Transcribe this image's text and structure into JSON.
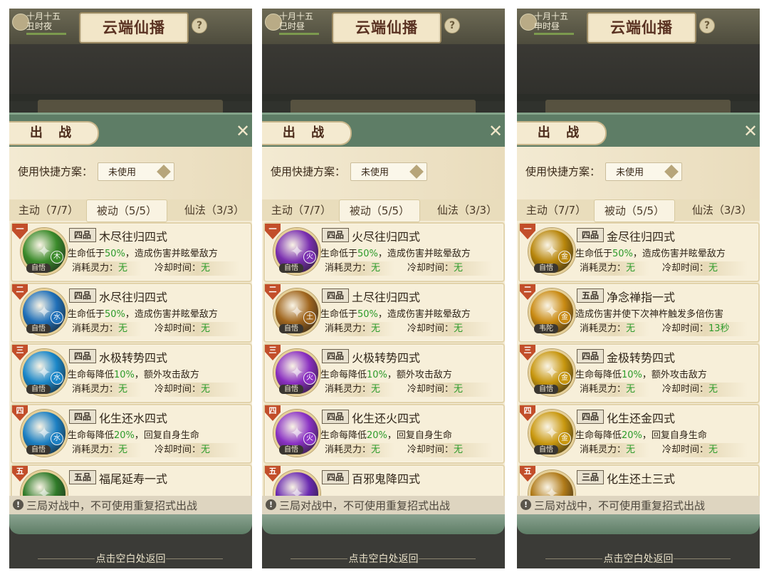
{
  "panels": [
    {
      "date_line1": "十月十五",
      "date_line2": "丑时夜",
      "title": "云端仙播",
      "dialog_title": "出 战",
      "scheme_label": "使用快捷方案：",
      "scheme_value": "未使用",
      "tabs": [
        "主动（7/7）",
        "被动（5/5）",
        "仙法（3/3）"
      ],
      "active_tab": 1,
      "skills": [
        {
          "num": "一",
          "grade": "四品",
          "name": "木尽往归四式",
          "desc_pre": "生命低于",
          "desc_pct": "50%",
          "desc_post": "，造成伤害并眩晕敌方",
          "cost_label": "消耗灵力：",
          "cost": "无",
          "cd_label": "冷却时间：",
          "cd": "无",
          "source": "自悟",
          "element": "木",
          "color": "#3a8a2a"
        },
        {
          "num": "二",
          "grade": "四品",
          "name": "水尽往归四式",
          "desc_pre": "生命低于",
          "desc_pct": "50%",
          "desc_post": "，造成伤害并眩晕敌方",
          "cost_label": "消耗灵力：",
          "cost": "无",
          "cd_label": "冷却时间：",
          "cd": "无",
          "source": "自悟",
          "element": "水",
          "color": "#1f6fb8"
        },
        {
          "num": "三",
          "grade": "四品",
          "name": "水极转势四式",
          "desc_pre": "生命每降低",
          "desc_pct": "10%",
          "desc_post": "，额外攻击敌方",
          "cost_label": "消耗灵力：",
          "cost": "无",
          "cd_label": "冷却时间：",
          "cd": "无",
          "source": "自悟",
          "element": "水",
          "color": "#1a86c8"
        },
        {
          "num": "四",
          "grade": "四品",
          "name": "化生还水四式",
          "desc_pre": "生命每降低",
          "desc_pct": "20%",
          "desc_post": "，回复自身生命",
          "cost_label": "消耗灵力：",
          "cost": "无",
          "cd_label": "冷却时间：",
          "cd": "无",
          "source": "自悟",
          "element": "水",
          "color": "#1b7fc2"
        },
        {
          "num": "五",
          "grade": "五品",
          "name": "福尾延寿一式",
          "desc_pre": "",
          "desc_pct": "",
          "desc_post": "",
          "cost_label": "",
          "cost": "",
          "cd_label": "",
          "cd": "",
          "source": "",
          "element": "",
          "color": "#2f7a28"
        }
      ],
      "notice": "三局对战中，不可使用重复招式出战",
      "return_text": "点击空白处返回"
    },
    {
      "date_line1": "十月十五",
      "date_line2": "巳时昼",
      "title": "云端仙播",
      "dialog_title": "出 战",
      "scheme_label": "使用快捷方案：",
      "scheme_value": "未使用",
      "tabs": [
        "主动（7/7）",
        "被动（5/5）",
        "仙法（3/3）"
      ],
      "active_tab": 1,
      "skills": [
        {
          "num": "一",
          "grade": "四品",
          "name": "火尽往归四式",
          "desc_pre": "生命低于",
          "desc_pct": "50%",
          "desc_post": "，造成伤害并眩晕敌方",
          "cost_label": "消耗灵力：",
          "cost": "无",
          "cd_label": "冷却时间：",
          "cd": "无",
          "source": "自悟",
          "element": "火",
          "color": "#7a2fb0"
        },
        {
          "num": "二",
          "grade": "四品",
          "name": "土尽往归四式",
          "desc_pre": "生命低于",
          "desc_pct": "50%",
          "desc_post": "，造成伤害并眩晕敌方",
          "cost_label": "消耗灵力：",
          "cost": "无",
          "cd_label": "冷却时间：",
          "cd": "无",
          "source": "自悟",
          "element": "土",
          "color": "#a0661e"
        },
        {
          "num": "三",
          "grade": "四品",
          "name": "火极转势四式",
          "desc_pre": "生命每降低",
          "desc_pct": "10%",
          "desc_post": "，额外攻击敌方",
          "cost_label": "消耗灵力：",
          "cost": "无",
          "cd_label": "冷却时间：",
          "cd": "无",
          "source": "自悟",
          "element": "火",
          "color": "#8a2fc0"
        },
        {
          "num": "四",
          "grade": "四品",
          "name": "化生还火四式",
          "desc_pre": "生命每降低",
          "desc_pct": "20%",
          "desc_post": "，回复自身生命",
          "cost_label": "消耗灵力：",
          "cost": "无",
          "cd_label": "冷却时间：",
          "cd": "无",
          "source": "自悟",
          "element": "火",
          "color": "#8a32c4"
        },
        {
          "num": "五",
          "grade": "四品",
          "name": "百邪鬼降四式",
          "desc_pre": "",
          "desc_pct": "",
          "desc_post": "",
          "cost_label": "",
          "cost": "",
          "cd_label": "",
          "cd": "",
          "source": "",
          "element": "",
          "color": "#6a2ab0"
        }
      ],
      "notice": "三局对战中，不可使用重复招式出战",
      "return_text": "点击空白处返回"
    },
    {
      "date_line1": "十月十五",
      "date_line2": "申时昼",
      "title": "云端仙播",
      "dialog_title": "出 战",
      "scheme_label": "使用快捷方案：",
      "scheme_value": "未使用",
      "tabs": [
        "主动（7/7）",
        "被动（5/5）",
        "仙法（3/3）"
      ],
      "active_tab": 1,
      "skills": [
        {
          "num": "一",
          "grade": "四品",
          "name": "金尽往归四式",
          "desc_pre": "生命低于",
          "desc_pct": "50%",
          "desc_post": "，造成伤害并眩晕敌方",
          "cost_label": "消耗灵力：",
          "cost": "无",
          "cd_label": "冷却时间：",
          "cd": "无",
          "source": "自悟",
          "element": "金",
          "color": "#b8860b"
        },
        {
          "num": "二",
          "grade": "五品",
          "name": "净念禅指一式",
          "desc_pre": "造成伤害并使下次神杵触发多倍伤害",
          "desc_pct": "",
          "desc_post": "",
          "cost_label": "消耗灵力：",
          "cost": "无",
          "cd_label": "冷却时间：",
          "cd": "13秒",
          "source": "韦陀",
          "element": "金",
          "color": "#c98a12"
        },
        {
          "num": "三",
          "grade": "四品",
          "name": "金极转势四式",
          "desc_pre": "生命每降低",
          "desc_pct": "10%",
          "desc_post": "，额外攻击敌方",
          "cost_label": "消耗灵力：",
          "cost": "无",
          "cd_label": "冷却时间：",
          "cd": "无",
          "source": "自悟",
          "element": "金",
          "color": "#c7960e"
        },
        {
          "num": "四",
          "grade": "四品",
          "name": "化生还金四式",
          "desc_pre": "生命每降低",
          "desc_pct": "20%",
          "desc_post": "，回复自身生命",
          "cost_label": "消耗灵力：",
          "cost": "无",
          "cd_label": "冷却时间：",
          "cd": "无",
          "source": "自悟",
          "element": "金",
          "color": "#c9980f"
        },
        {
          "num": "五",
          "grade": "三品",
          "name": "化生还土三式",
          "desc_pre": "",
          "desc_pct": "",
          "desc_post": "",
          "cost_label": "",
          "cost": "",
          "cd_label": "",
          "cd": "",
          "source": "",
          "element": "",
          "color": "#b07a18"
        }
      ],
      "notice": "三局对战中，不可使用重复招式出战",
      "return_text": "点击空白处返回"
    }
  ]
}
